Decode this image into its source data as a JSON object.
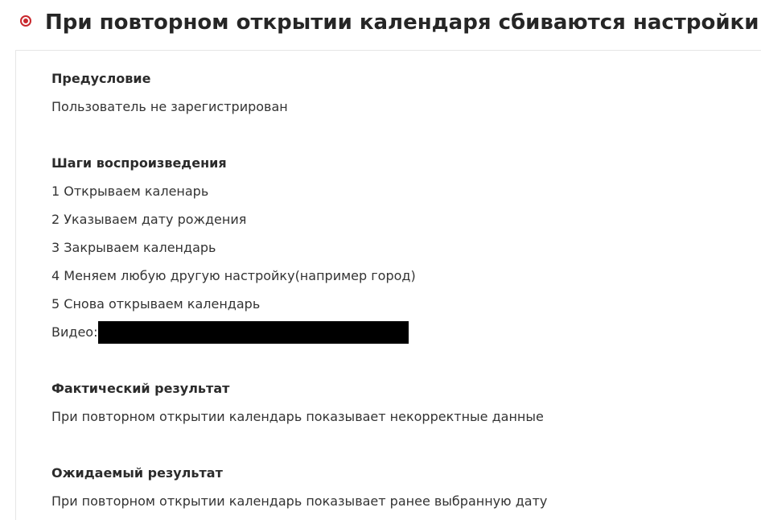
{
  "title": "При повторном открытии календаря сбиваются настройки",
  "precondition": {
    "heading": "Предусловие",
    "text": "Пользователь не зарегистрирован"
  },
  "steps": {
    "heading": "Шаги воспроизведения",
    "items": [
      "1 Открываем каленарь",
      "2 Указываем дату рождения",
      "3 Закрываем календарь",
      "4 Меняем любую другую настройку(например город)",
      "5 Снова открываем календарь"
    ],
    "video_label": "Видео:"
  },
  "actual": {
    "heading": "Фактический результат",
    "text": "При повторном открытии календарь показывает некорректные данные"
  },
  "expected": {
    "heading": "Ожидаемый результат",
    "text": "При повторном открытии календарь показывает ранее выбранную дату"
  },
  "colors": {
    "status_icon": "#c9282d"
  },
  "icons": {
    "status": "radio-bullet-icon"
  }
}
